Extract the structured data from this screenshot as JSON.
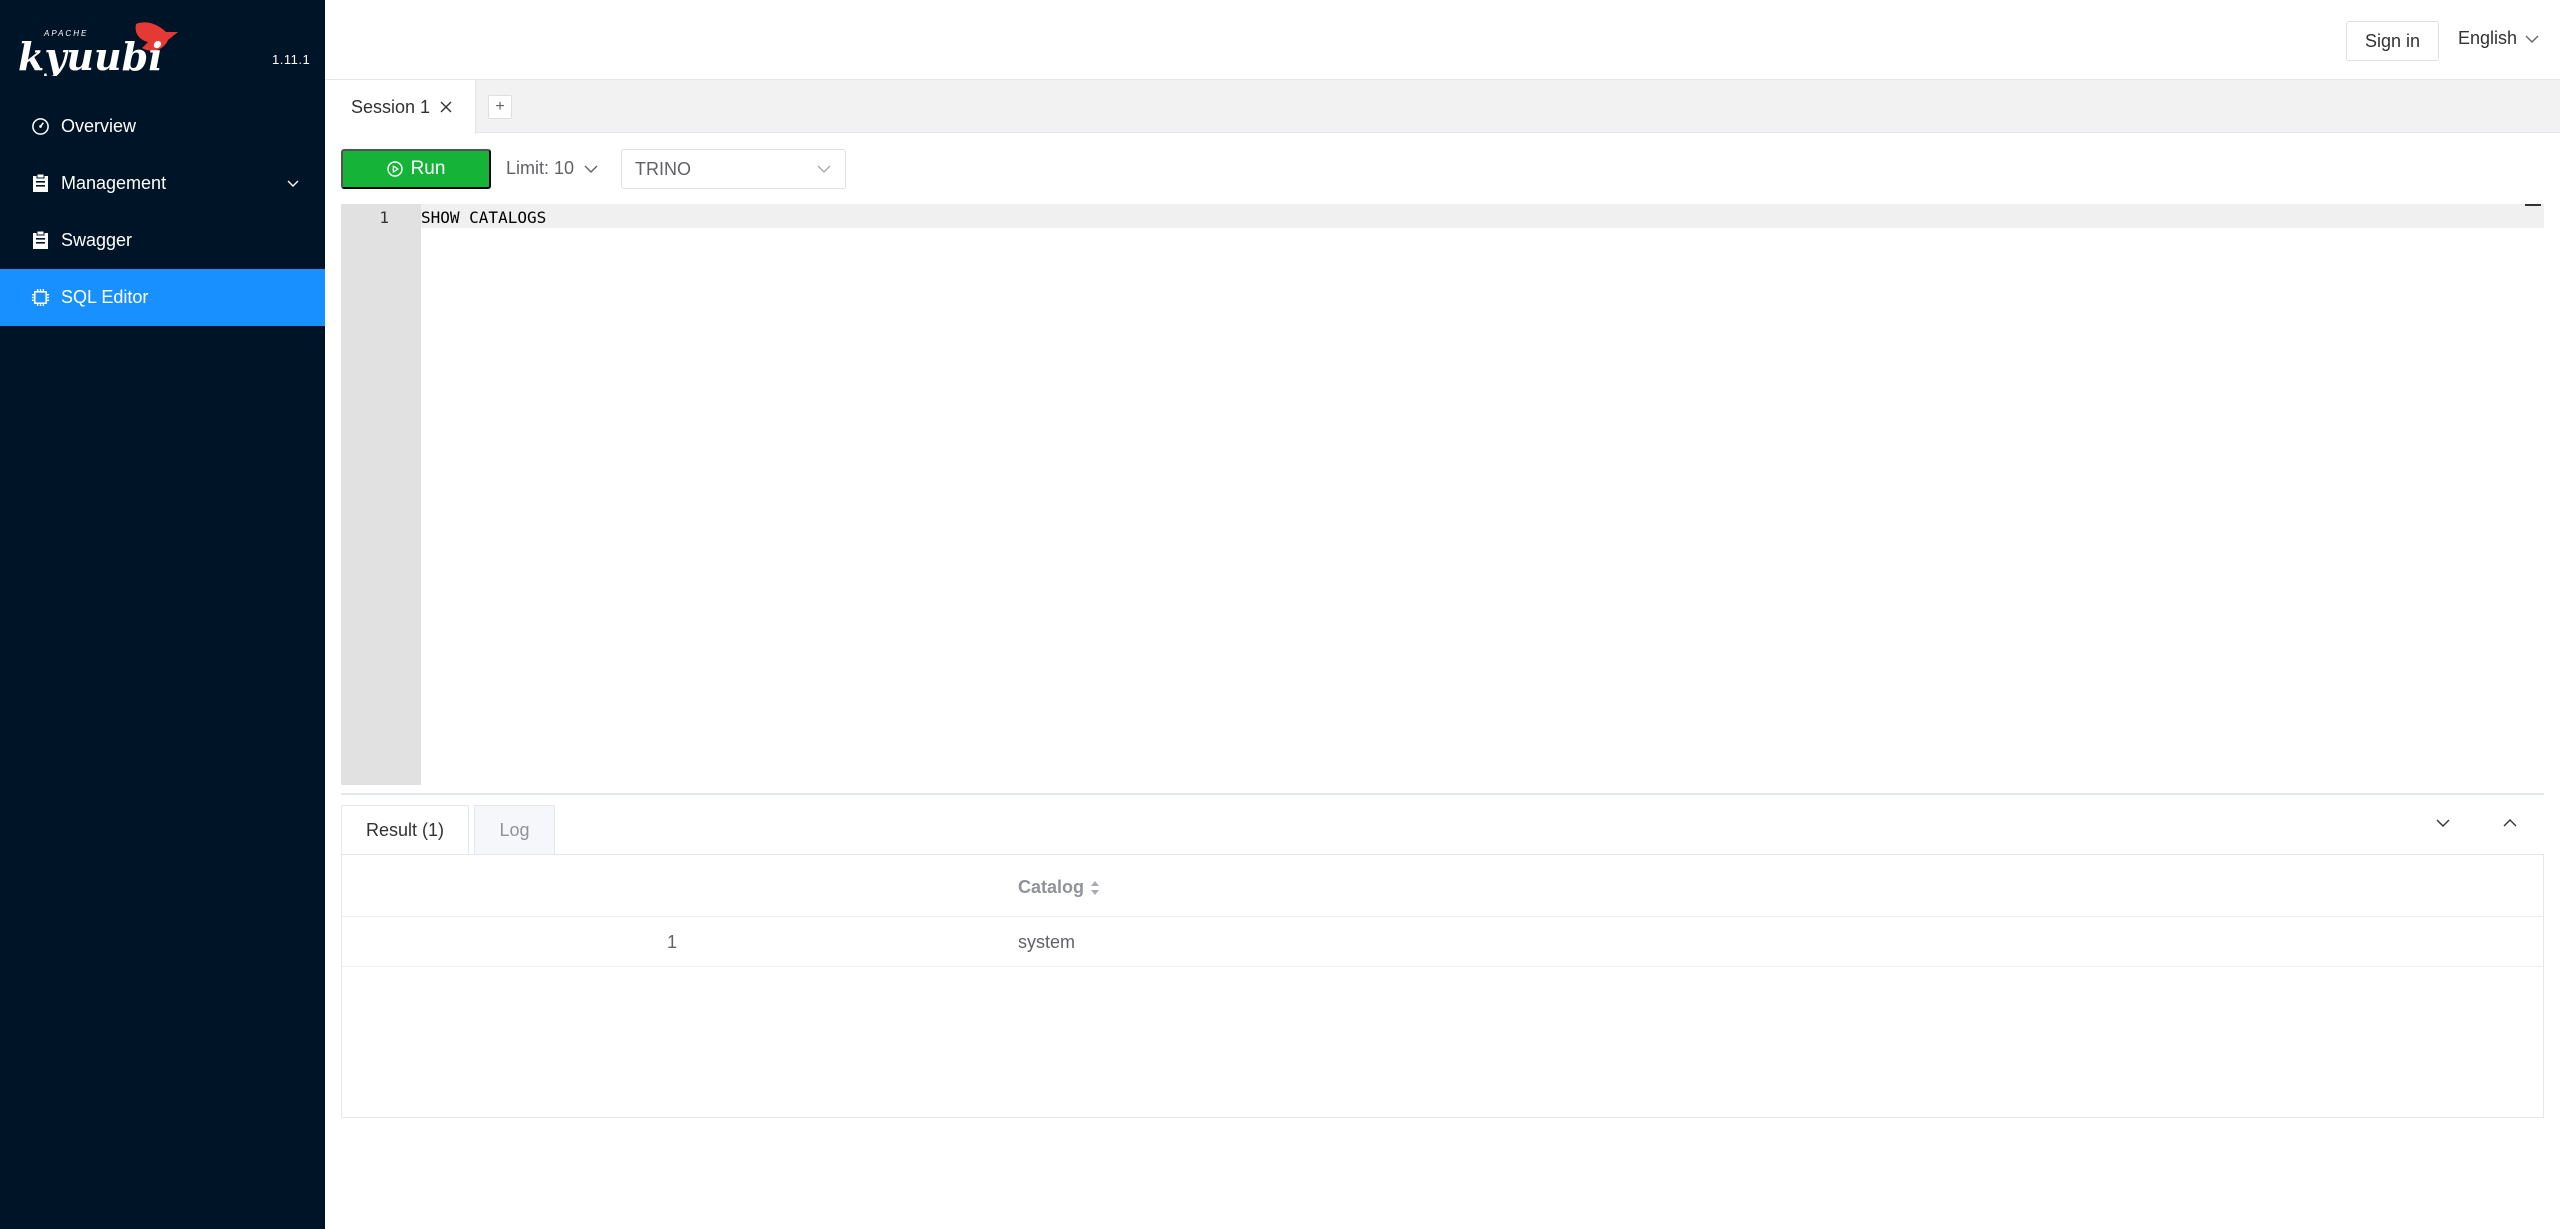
{
  "sidebar": {
    "logo_small": "APACHE",
    "logo_text": "kyuubi",
    "version": "1.11.1",
    "items": [
      {
        "label": "Overview",
        "icon": "gauge-icon"
      },
      {
        "label": "Management",
        "icon": "clipboard-icon"
      },
      {
        "label": "Swagger",
        "icon": "clipboard-icon"
      },
      {
        "label": "SQL Editor",
        "icon": "cpu-icon",
        "active": true
      }
    ]
  },
  "header": {
    "sign_in": "Sign in",
    "language": "English"
  },
  "sessions": {
    "tabs": [
      {
        "label": "Session 1"
      }
    ],
    "add_label": "+"
  },
  "toolbar": {
    "run_label": "Run",
    "limit_label": "Limit: 10",
    "engine_value": "TRINO"
  },
  "editor": {
    "lines": [
      {
        "number": "1",
        "code": "SHOW CATALOGS"
      }
    ]
  },
  "results": {
    "tabs": [
      {
        "label": "Result (1)"
      },
      {
        "label": "Log"
      }
    ],
    "columns": [
      "Catalog"
    ],
    "rows": [
      {
        "index": "1",
        "catalog": "system"
      }
    ]
  },
  "colors": {
    "sidebar_bg": "#001428",
    "active_menu": "#1890ff",
    "run_button": "#16b339"
  }
}
